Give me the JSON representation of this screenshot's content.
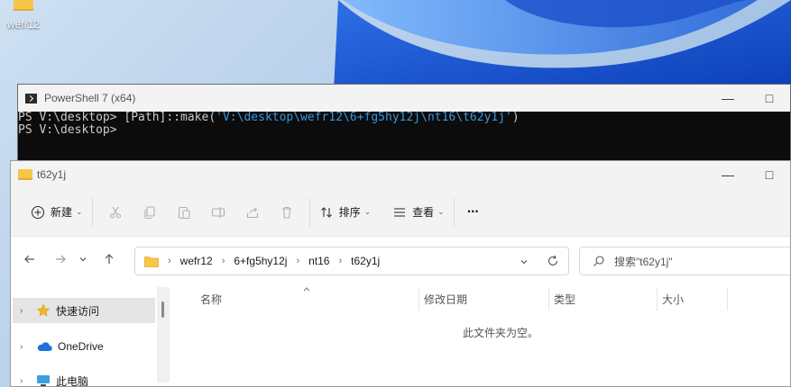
{
  "desktop": {
    "icon_label": "wefr12"
  },
  "powershell": {
    "title": "PowerShell 7 (x64)",
    "lines": [
      {
        "prompt": "PS V:\\desktop> ",
        "command": "[Path]::make(",
        "string": "'V:\\desktop\\wefr12\\6+fg5hy12j\\nt16\\t62y1j'",
        "tail": ")"
      },
      {
        "prompt": "PS V:\\desktop>",
        "command": "",
        "string": "",
        "tail": ""
      }
    ]
  },
  "explorer": {
    "title": "t62y1j",
    "toolbar": {
      "new_label": "新建",
      "sort_label": "排序",
      "view_label": "查看",
      "more_label": "···"
    },
    "breadcrumb": [
      "wefr12",
      "6+fg5hy12j",
      "nt16",
      "t62y1j"
    ],
    "search_placeholder": "搜索\"t62y1j\"",
    "sidebar": [
      {
        "label": "快速访问"
      },
      {
        "label": "OneDrive"
      },
      {
        "label": "此电脑"
      }
    ],
    "columns": [
      "名称",
      "修改日期",
      "类型",
      "大小"
    ],
    "empty_message": "此文件夹为空。"
  },
  "colors": {
    "ps_background": "#0c0c0c",
    "ps_text": "#cccccc",
    "ps_string": "#3a96dd",
    "folder": "#f6c64a",
    "selected_bg": "#e5e5e5"
  }
}
